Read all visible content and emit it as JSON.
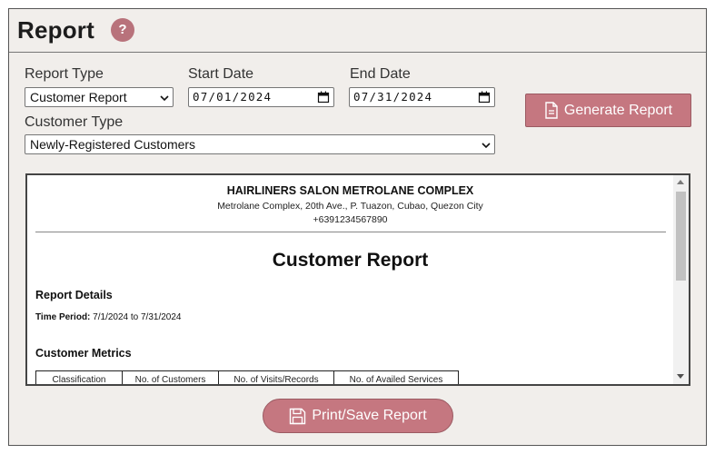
{
  "header": {
    "title": "Report",
    "help_glyph": "?"
  },
  "form": {
    "report_type": {
      "label": "Report Type",
      "value": "Customer Report"
    },
    "start_date": {
      "label": "Start Date",
      "value": "07/01/2024"
    },
    "end_date": {
      "label": "End Date",
      "value": "07/31/2024"
    },
    "customer_type": {
      "label": "Customer Type",
      "value": "Newly-Registered Customers"
    },
    "generate_label": "Generate Report"
  },
  "report": {
    "business_name": "HAIRLINERS SALON METROLANE COMPLEX",
    "address": "Metrolane Complex, 20th Ave., P. Tuazon, Cubao, Quezon City",
    "phone": "+6391234567890",
    "title": "Customer Report",
    "details_heading": "Report Details",
    "time_period_label": "Time Period:",
    "time_period_value": "7/1/2024 to 7/31/2024",
    "metrics_heading": "Customer Metrics",
    "columns": [
      "Classification",
      "No. of Customers",
      "No. of Visits/Records",
      "No. of Availed Services"
    ]
  },
  "print_label": "Print/Save Report",
  "colors": {
    "accent": "#c57780",
    "panel_bg": "#f1eeeb"
  },
  "icons": {
    "help": "help-icon",
    "generate": "document-icon",
    "print": "save-icon"
  }
}
